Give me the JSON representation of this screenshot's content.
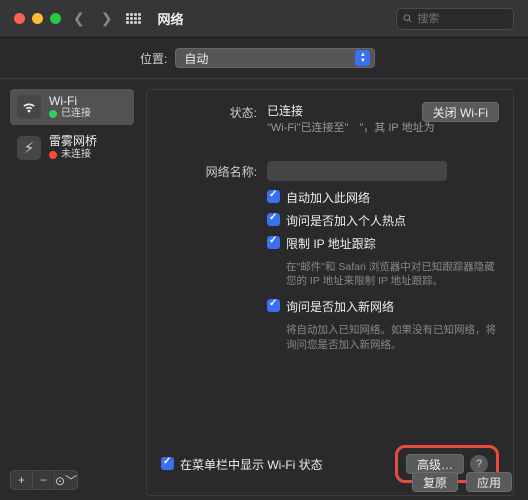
{
  "window": {
    "title": "网络",
    "search_placeholder": "搜索"
  },
  "location": {
    "label": "位置:",
    "value": "自动"
  },
  "sidebar": {
    "items": [
      {
        "name": "Wi-Fi",
        "status": "已连接",
        "dot": "green"
      },
      {
        "name": "雷雾网桥",
        "status": "未连接",
        "dot": "red"
      }
    ]
  },
  "panel": {
    "status_label": "状态:",
    "status_value": "已连接",
    "off_btn": "关闭 Wi-Fi",
    "status_sub_left": "\"Wi-Fi\"已连接至\"",
    "status_sub_right": "\"，其 IP 地址为",
    "netname_label": "网络名称:",
    "checks": [
      {
        "label": "自动加入此网络",
        "help": ""
      },
      {
        "label": "询问是否加入个人热点",
        "help": ""
      },
      {
        "label": "限制 IP 地址跟踪",
        "help": "在\"邮件\"和 Safari 浏览器中对已知跟踪器隐藏您的 IP 地址来限制 IP 地址跟踪。"
      },
      {
        "label": "询问是否加入新网络",
        "help": "将自动加入已知网络。如果没有已知网络，将询问您是否加入新网络。"
      }
    ],
    "menubar_label": "在菜单栏中显示 Wi-Fi 状态",
    "advanced_btn": "高级…"
  },
  "footer": {
    "revert": "复原",
    "apply": "应用"
  }
}
